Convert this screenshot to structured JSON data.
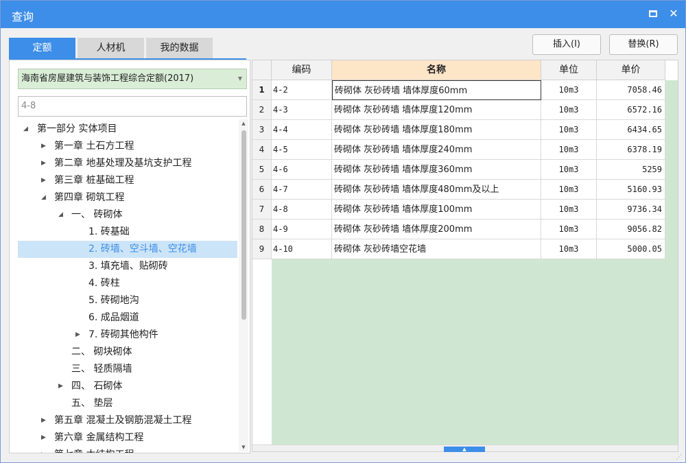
{
  "window": {
    "title": "查询"
  },
  "tabs": [
    {
      "label": "定额",
      "active": true
    },
    {
      "label": "人材机",
      "active": false
    },
    {
      "label": "我的数据",
      "active": false
    }
  ],
  "buttons": {
    "insert": "插入(I)",
    "replace": "替换(R)"
  },
  "quota_selector": {
    "value": "海南省房屋建筑与装饰工程综合定额(2017)"
  },
  "search": {
    "value": "4-8"
  },
  "tree": [
    {
      "label": "第一部分 实体项目",
      "toggle": "◢"
    },
    {
      "label": "第一章 土石方工程",
      "toggle": "▶"
    },
    {
      "label": "第二章 地基处理及基坑支护工程",
      "toggle": "▶"
    },
    {
      "label": "第三章 桩基础工程",
      "toggle": "▶"
    },
    {
      "label": "第四章 砌筑工程",
      "toggle": "◢"
    },
    {
      "label": "一、 砖砌体",
      "toggle": "◢"
    },
    {
      "label": "1. 砖基础",
      "toggle": ""
    },
    {
      "label": "2. 砖墙、空斗墙、空花墙",
      "toggle": "",
      "selected": true
    },
    {
      "label": "3. 填充墙、贴砌砖",
      "toggle": ""
    },
    {
      "label": "4. 砖柱",
      "toggle": ""
    },
    {
      "label": "5. 砖砌地沟",
      "toggle": ""
    },
    {
      "label": "6. 成品烟道",
      "toggle": ""
    },
    {
      "label": "7. 砖砌其他构件",
      "toggle": "▶"
    },
    {
      "label": "二、 砌块砌体",
      "toggle": ""
    },
    {
      "label": "三、 轻质隔墙",
      "toggle": ""
    },
    {
      "label": "四、 石砌体",
      "toggle": "▶"
    },
    {
      "label": "五、 垫层",
      "toggle": ""
    },
    {
      "label": "第五章 混凝土及钢筋混凝土工程",
      "toggle": "▶"
    },
    {
      "label": "第六章 金属结构工程",
      "toggle": "▶"
    },
    {
      "label": "第七章 木结构工程",
      "toggle": "▶"
    }
  ],
  "table": {
    "columns": [
      "编码",
      "名称",
      "单位",
      "单价"
    ],
    "rows": [
      {
        "no": "1",
        "code": "4-2",
        "name": "砖砌体 灰砂砖墙 墙体厚度60mm",
        "unit": "10m3",
        "price": "7058.46"
      },
      {
        "no": "2",
        "code": "4-3",
        "name": "砖砌体 灰砂砖墙 墙体厚度120mm",
        "unit": "10m3",
        "price": "6572.16"
      },
      {
        "no": "3",
        "code": "4-4",
        "name": "砖砌体 灰砂砖墙 墙体厚度180mm",
        "unit": "10m3",
        "price": "6434.65"
      },
      {
        "no": "4",
        "code": "4-5",
        "name": "砖砌体 灰砂砖墙 墙体厚度240mm",
        "unit": "10m3",
        "price": "6378.19"
      },
      {
        "no": "5",
        "code": "4-6",
        "name": "砖砌体 灰砂砖墙 墙体厚度360mm",
        "unit": "10m3",
        "price": "5259"
      },
      {
        "no": "6",
        "code": "4-7",
        "name": "砖砌体 灰砂砖墙 墙体厚度480mm及以上",
        "unit": "10m3",
        "price": "5160.93"
      },
      {
        "no": "7",
        "code": "4-8",
        "name": "砖砌体 灰砂砖墙 墙体厚度100mm",
        "unit": "10m3",
        "price": "9736.34"
      },
      {
        "no": "8",
        "code": "4-9",
        "name": "砖砌体 灰砂砖墙 墙体厚度200mm",
        "unit": "10m3",
        "price": "9056.82"
      },
      {
        "no": "9",
        "code": "4-10",
        "name": "砖砌体 灰砂砖墙空花墙",
        "unit": "10m3",
        "price": "5000.05"
      }
    ]
  },
  "icons": {
    "maximize": "maximize-icon",
    "close": "close-icon",
    "dropdown": "chevron-down-icon"
  },
  "colors": {
    "accent": "#3d8ee8",
    "selector_bg": "#d9edd7",
    "grid_empty": "#cfe7d2",
    "active_header": "#fde5c8",
    "tree_selected": "#cce4f7"
  }
}
